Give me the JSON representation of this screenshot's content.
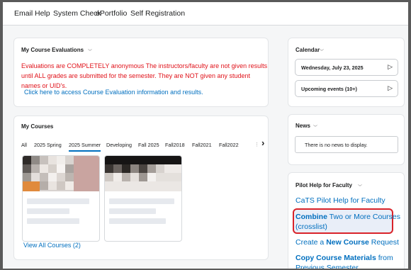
{
  "nav": {
    "items": [
      "Email",
      "Help",
      "System Check",
      "ePortfolio",
      "Self Registration"
    ]
  },
  "evaluations": {
    "title": "My Course Evaluations",
    "notice": "Evaluations are COMPLETELY anonymous The instructors/faculty are not given results until ALL grades are submitted for the semester. They are NOT given any student names or UID's.",
    "link": "Click here to access Course Evaluation information and results."
  },
  "courses": {
    "title": "My Courses",
    "tabs": [
      "All",
      "2025 Spring",
      "2025 Summer",
      "Developing",
      "Fall 2025",
      "Fall2018",
      "Fall2021",
      "Fall2022"
    ],
    "active_tab": "2025 Summer",
    "view_all": "View All Courses (2)"
  },
  "calendar": {
    "title": "Calendar",
    "date": "Wednesday, July 23, 2025",
    "upcoming": "Upcoming events (10+)"
  },
  "news": {
    "title": "News",
    "empty": "There is no news to display."
  },
  "pilot": {
    "title": "Pilot Help for Faculty",
    "link1": "CaTS Pilot Help for Faculty",
    "link2_bold": "Combine",
    "link2_rest": " Two or More Courses",
    "link2_line2": "(crosslist)",
    "link3_pre": "Create a ",
    "link3_bold": "New Course",
    "link3_post": " Request",
    "link4_bold1": "Copy Course Materials",
    "link4_rest": " from",
    "link4_line2": "Previous Semester"
  },
  "colors": {
    "link": "#006fbf",
    "alert_text": "#e0121a",
    "highlight_border": "#d9232a"
  },
  "icons": {
    "collapse": "chevron-down-icon",
    "next": "chevron-right-icon"
  }
}
